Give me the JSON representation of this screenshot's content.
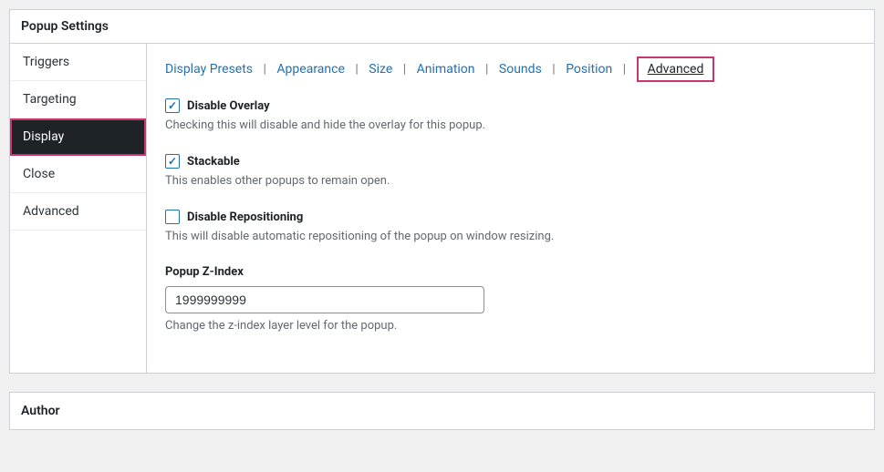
{
  "panel": {
    "title": "Popup Settings"
  },
  "sidebar": {
    "items": [
      {
        "label": "Triggers"
      },
      {
        "label": "Targeting"
      },
      {
        "label": "Display"
      },
      {
        "label": "Close"
      },
      {
        "label": "Advanced"
      }
    ]
  },
  "subtabs": {
    "items": [
      "Display Presets",
      "Appearance",
      "Size",
      "Animation",
      "Sounds",
      "Position"
    ],
    "active": "Advanced",
    "separator": "|"
  },
  "options": {
    "disable_overlay": {
      "label": "Disable Overlay",
      "desc": "Checking this will disable and hide the overlay for this popup."
    },
    "stackable": {
      "label": "Stackable",
      "desc": "This enables other popups to remain open."
    },
    "disable_repositioning": {
      "label": "Disable Repositioning",
      "desc": "This will disable automatic repositioning of the popup on window resizing."
    },
    "zindex": {
      "label": "Popup Z-Index",
      "value": "1999999999",
      "desc": "Change the z-index layer level for the popup."
    }
  },
  "author": {
    "title": "Author"
  }
}
